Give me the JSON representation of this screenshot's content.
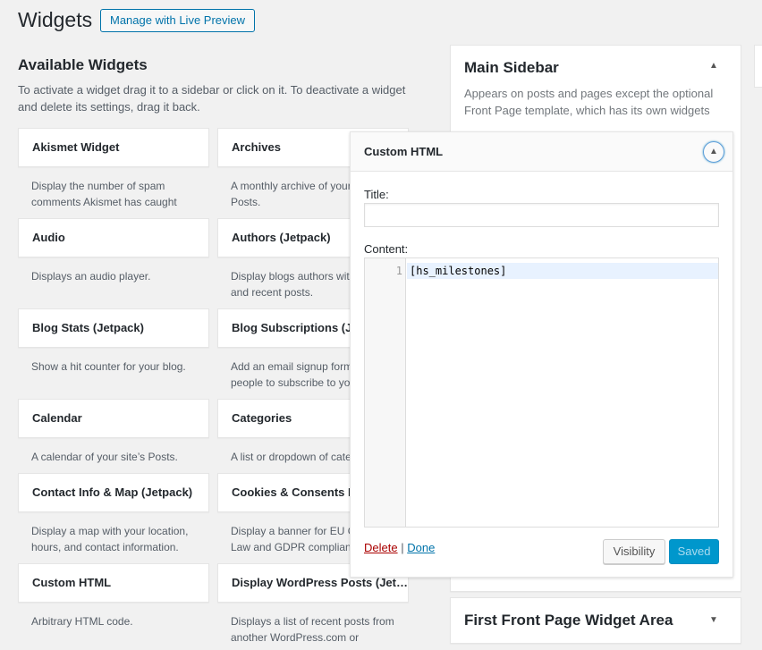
{
  "header": {
    "title": "Widgets",
    "live_preview_label": "Manage with Live Preview"
  },
  "available": {
    "title": "Available Widgets",
    "description": "To activate a widget drag it to a sidebar or click on it. To deactivate a widget and delete its settings, drag it back.",
    "widgets": [
      {
        "title": "Akismet Widget",
        "desc": "Display the number of spam comments Akismet has caught"
      },
      {
        "title": "Archives",
        "desc": "A monthly archive of your site’s Posts."
      },
      {
        "title": "Audio",
        "desc": "Displays an audio player."
      },
      {
        "title": "Authors (Jetpack)",
        "desc": "Display blogs authors with avatars and recent posts."
      },
      {
        "title": "Blog Stats (Jetpack)",
        "desc": "Show a hit counter for your blog."
      },
      {
        "title": "Blog Subscriptions (Jetpack)",
        "desc": "Add an email signup form to allow people to subscribe to your blog."
      },
      {
        "title": "Calendar",
        "desc": "A calendar of your site’s Posts."
      },
      {
        "title": "Categories",
        "desc": "A list or dropdown of categories."
      },
      {
        "title": "Contact Info & Map (Jetpack)",
        "desc": "Display a map with your location, hours, and contact information."
      },
      {
        "title": "Cookies & Consents Banner",
        "desc": "Display a banner for EU Cookie Law and GDPR compliance."
      },
      {
        "title": "Custom HTML",
        "desc": "Arbitrary HTML code."
      },
      {
        "title": "Display WordPress Posts (Jet…",
        "desc": "Displays a list of recent posts from another WordPress.com or"
      }
    ]
  },
  "main_sidebar": {
    "title": "Main Sidebar",
    "description": "Appears on posts and pages except the optional Front Page template, which has its own widgets",
    "arrow_icon": "▲"
  },
  "custom_html_widget": {
    "title": "Custom HTML",
    "toggle_icon": "▲",
    "title_label": "Title:",
    "title_value": "",
    "content_label": "Content:",
    "line_number": "1",
    "code": "[hs_milestones]",
    "delete_label": "Delete",
    "separator": "|",
    "done_label": "Done",
    "visibility_label": "Visibility",
    "saved_label": "Saved"
  },
  "first_front_page": {
    "title": "First Front Page Widget Area",
    "arrow_icon": "▼"
  },
  "colors": {
    "accent": "#0073aa",
    "saved_button": "#0097cc",
    "delete": "#aa0000",
    "background": "#f1f1f1"
  }
}
